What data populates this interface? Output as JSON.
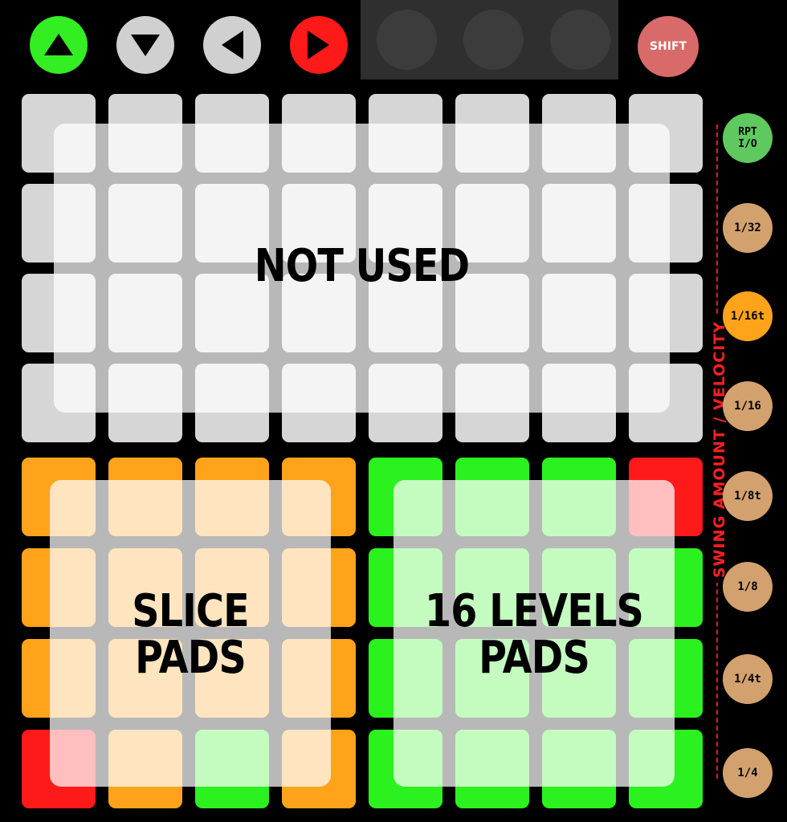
{
  "nav_buttons": [
    {
      "name": "up-arrow-button",
      "icon": "triangle-up-icon",
      "color": "#33ee22"
    },
    {
      "name": "down-arrow-button",
      "icon": "triangle-down-icon",
      "color": "#d0d0d0"
    },
    {
      "name": "left-arrow-button",
      "icon": "triangle-left-icon",
      "color": "#d0d0d0"
    },
    {
      "name": "right-arrow-button",
      "icon": "triangle-right-icon",
      "color": "#ff1a1a"
    }
  ],
  "shift_label": "SHIFT",
  "overlays": {
    "top": "NOT USED",
    "slice": [
      "SLICE",
      "PADS"
    ],
    "levels": [
      "16 LEVELS",
      "PADS"
    ]
  },
  "pad_colors": {
    "grey": "#d6d6d6",
    "orange": "#ffa31a",
    "green": "#2bf21f",
    "red": "#ff1a1a"
  },
  "pad_grid": [
    [
      "grey",
      "grey",
      "grey",
      "grey",
      "grey",
      "grey",
      "grey",
      "grey"
    ],
    [
      "grey",
      "grey",
      "grey",
      "grey",
      "grey",
      "grey",
      "grey",
      "grey"
    ],
    [
      "grey",
      "grey",
      "grey",
      "grey",
      "grey",
      "grey",
      "grey",
      "grey"
    ],
    [
      "grey",
      "grey",
      "grey",
      "grey",
      "grey",
      "grey",
      "grey",
      "grey"
    ],
    [
      "orange",
      "orange",
      "orange",
      "orange",
      "green",
      "green",
      "green",
      "red"
    ],
    [
      "orange",
      "orange",
      "orange",
      "orange",
      "green",
      "green",
      "green",
      "green"
    ],
    [
      "orange",
      "orange",
      "orange",
      "orange",
      "green",
      "green",
      "green",
      "green"
    ],
    [
      "red",
      "orange",
      "green",
      "orange",
      "green",
      "green",
      "green",
      "green"
    ]
  ],
  "side_buttons": [
    {
      "label_top": "RPT",
      "label_bottom": "I/O",
      "color": "green"
    },
    {
      "label": "1/32",
      "color": "tan"
    },
    {
      "label": "1/16t",
      "color": "orange"
    },
    {
      "label": "1/16",
      "color": "tan"
    },
    {
      "label": "1/8t",
      "color": "tan"
    },
    {
      "label": "1/8",
      "color": "tan"
    },
    {
      "label": "1/4t",
      "color": "tan"
    },
    {
      "label": "1/4",
      "color": "tan"
    }
  ],
  "side_label": "SWING AMOUNT / VELOCITY"
}
